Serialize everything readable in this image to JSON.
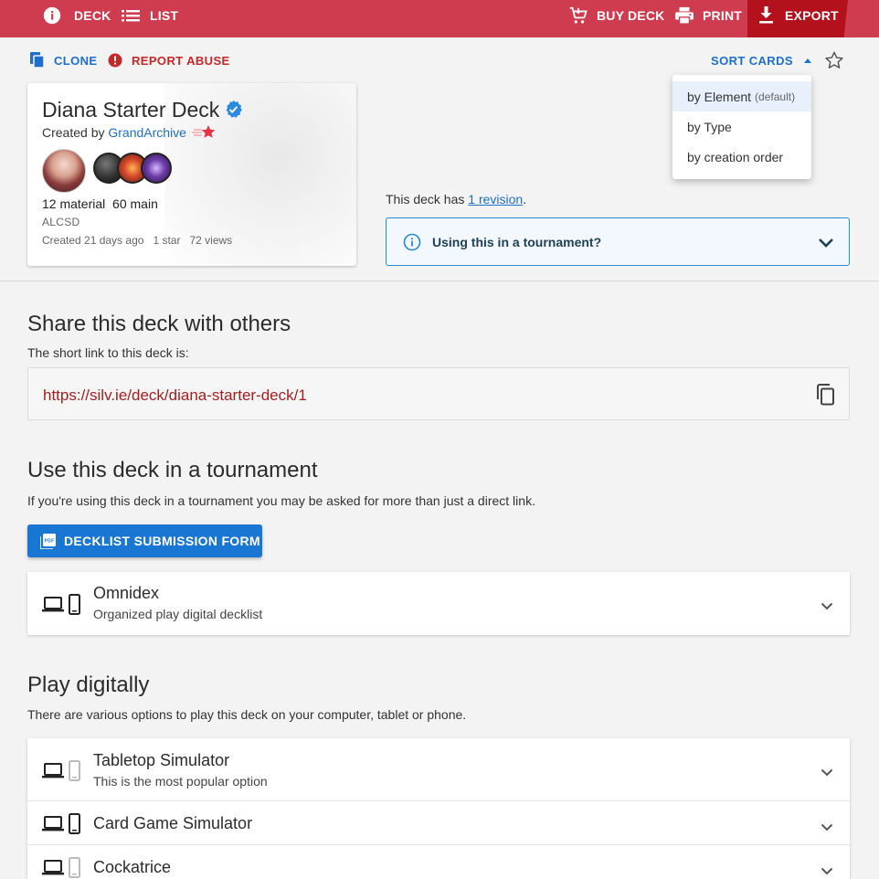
{
  "topbar": {
    "deck_label": "DECK",
    "list_label": "LIST",
    "buy_label": "BUY DECK",
    "print_label": "PRINT",
    "export_label": "EXPORT"
  },
  "actions": {
    "clone_label": "CLONE",
    "report_label": "REPORT ABUSE",
    "sort_label": "SORT CARDS"
  },
  "sort_menu": {
    "items": [
      {
        "label": "by Element",
        "note": "(default)"
      },
      {
        "label": "by Type",
        "note": ""
      },
      {
        "label": "by creation order",
        "note": ""
      }
    ]
  },
  "deck": {
    "title": "Diana Starter Deck",
    "created_by_prefix": "Created by",
    "author": "GrandArchive",
    "material_count": "12 material",
    "main_count": "60 main",
    "set_code": "ALCSD",
    "created": "Created 21 days ago",
    "stars": "1 star",
    "views": "72 views"
  },
  "revision": {
    "prefix": "This deck has",
    "link": "1 revision",
    "suffix": "."
  },
  "tournament_box": {
    "label": "Using this in a tournament?"
  },
  "share": {
    "heading": "Share this deck with others",
    "intro": "The short link to this deck is:",
    "url": "https://silv.ie/deck/diana-starter-deck/1"
  },
  "tournament": {
    "heading": "Use this deck in a tournament",
    "intro": "If you're using this deck in a tournament you may be asked for more than just a direct link.",
    "pdf_button": "DECKLIST SUBMISSION FORM",
    "options": [
      {
        "title": "Omnidex",
        "subtitle": "Organized play digital decklist"
      }
    ]
  },
  "play": {
    "heading": "Play digitally",
    "intro": "There are various options to play this deck on your computer, tablet or phone.",
    "options": [
      {
        "title": "Tabletop Simulator",
        "subtitle": "This is the most popular option"
      },
      {
        "title": "Card Game Simulator",
        "subtitle": ""
      },
      {
        "title": "Cockatrice",
        "subtitle": ""
      }
    ]
  },
  "colors": {
    "brand": "#cf3c4f",
    "export_bg": "#b3121d",
    "link": "#1e6fc9",
    "primary_button": "#1976d2",
    "report": "#c62828"
  }
}
